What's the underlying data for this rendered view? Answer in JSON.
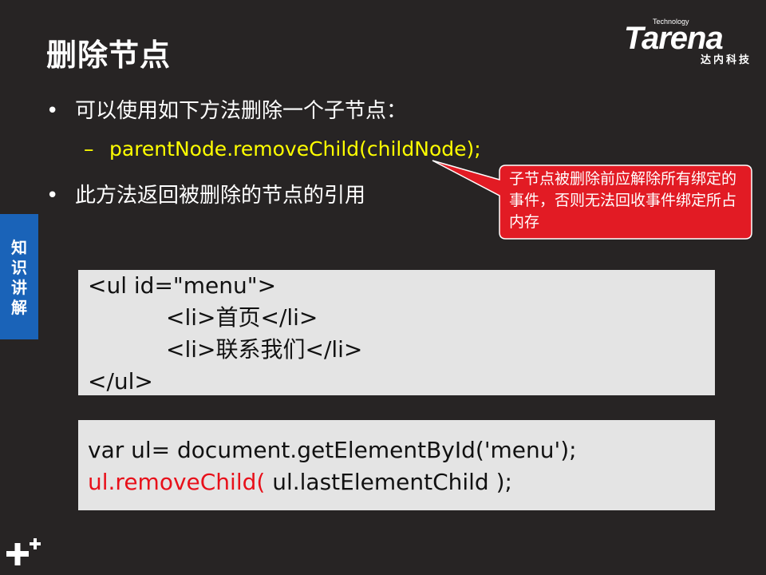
{
  "slide": {
    "title": "删除节点",
    "logo": {
      "small": "Technology",
      "word": "Tarena",
      "cn": "达内科技"
    },
    "bullets": [
      {
        "text": "可以使用如下方法删除一个子节点："
      },
      {
        "text": "此方法返回被删除的节点的引用"
      }
    ],
    "sub_bullet": {
      "dash": "–",
      "text": "parentNode.removeChild(childNode);"
    },
    "callout": {
      "text": "子节点被删除前应解除所有绑定的事件，否则无法回收事件绑定所占内存"
    },
    "side_tab": {
      "label": "知识讲解"
    },
    "code1": {
      "lines": [
        "<ul id=\"menu\">",
        "<li>首页</li>",
        "<li>联系我们</li>",
        "</ul>"
      ]
    },
    "code2": {
      "line1": "var ul= document.getElementById('menu');",
      "line2_red": "ul.removeChild(",
      "line2_rest": " ul.lastElementChild );"
    },
    "bullet_dot": "•",
    "colors": {
      "background": "#272424",
      "accent_yellow": "#ffff00",
      "callout_red": "#e21b24",
      "side_blue": "#1a63b8",
      "code_red": "#e8101a"
    },
    "icons": {
      "corner": "plus-icon"
    }
  }
}
